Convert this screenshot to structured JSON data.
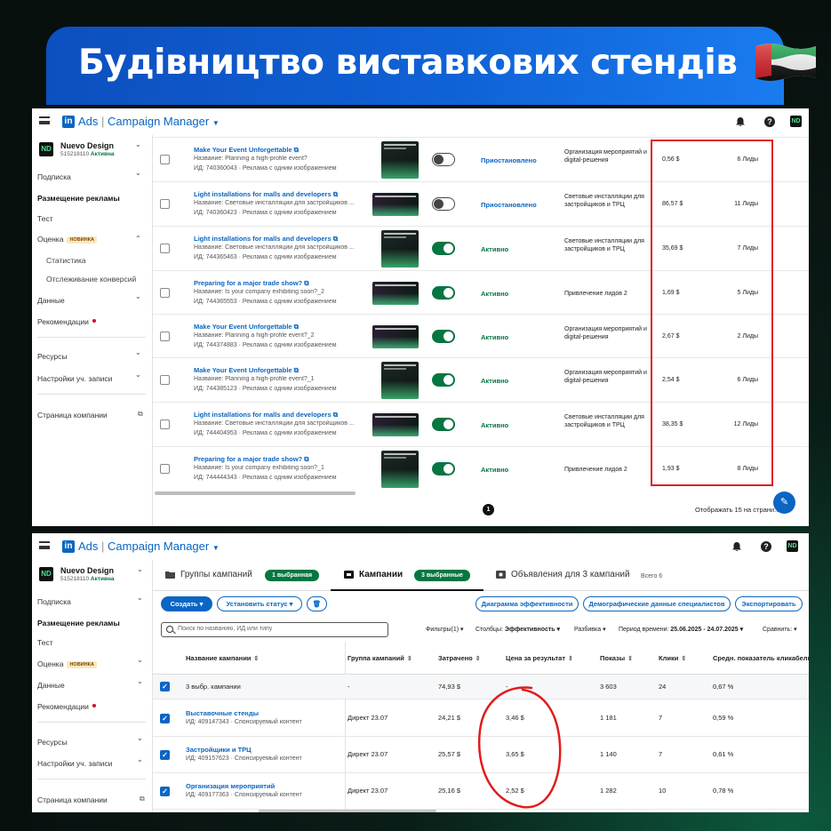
{
  "banner": {
    "title": "Будівництво виставкових стендів"
  },
  "app": {
    "logo_glyph": "in",
    "brand_ads": "Ads",
    "brand_sep": "|",
    "brand_name": "Campaign Manager",
    "brand_caret": "▼",
    "help_glyph": "?",
    "app_glyph": "ND",
    "account_glyph": "ND"
  },
  "account": {
    "name": "Nuevo Design",
    "id": "515218110",
    "status": "Активна"
  },
  "sidebar": {
    "subscription": "Подписка",
    "ads_placement": "Размещение рекламы",
    "test": "Тест",
    "evaluation": "Оценка",
    "new_badge": "НОВИНКА",
    "statistics": "Статистика",
    "conversion_tracking": "Отслеживание конверсий",
    "data": "Данные",
    "recommendations": "Рекомендации",
    "resources": "Ресурсы",
    "account_settings": "Настройки уч. записи",
    "company_page": "Страница компании",
    "chevron_down": "⌄",
    "chevron_up": "⌃",
    "external": "⧉"
  },
  "ads_table": {
    "rows": [
      {
        "title": "Make Your Event Unforgettable ⧉",
        "name": "Название: Planning a high-profile event?",
        "id": "ИД: 740360043 · Реклама с одним изображением",
        "status": "Приостановлено",
        "active": false,
        "goal": "Организация мероприятий и digital-решения",
        "cost": "0,56 $",
        "leads": "6 Лиды",
        "thumb": "tall"
      },
      {
        "title": "Light installations for malls and developers ⧉",
        "name": "Название: Световые инсталляции для застройщиков ...",
        "id": "ИД: 740360423 · Реклама с одним изображением",
        "status": "Приостановлено",
        "active": false,
        "goal": "Световые инсталляции для застройщиков и ТРЦ",
        "cost": "86,57 $",
        "leads": "11 Лиды",
        "thumb": "wide"
      },
      {
        "title": "Light installations for malls and developers ⧉",
        "name": "Название: Световые инсталляции для застройщиков ...",
        "id": "ИД: 744365463 · Реклама с одним изображением",
        "status": "Активно",
        "active": true,
        "goal": "Световые инсталляции для застройщиков и ТРЦ",
        "cost": "35,69 $",
        "leads": "7 Лиды",
        "thumb": "tall"
      },
      {
        "title": "Preparing for a major trade show? ⧉",
        "name": "Название: Is your company exhibiting soon?_2",
        "id": "ИД: 744365553 · Реклама с одним изображением",
        "status": "Активно",
        "active": true,
        "goal": "Привлечение лидов 2",
        "cost": "1,69 $",
        "leads": "5 Лиды",
        "thumb": "wide"
      },
      {
        "title": "Make Your Event Unforgettable ⧉",
        "name": "Название: Planning a high-profile event?_2",
        "id": "ИД: 744374883 · Реклама с одним изображением",
        "status": "Активно",
        "active": true,
        "goal": "Организация мероприятий и digital-решения",
        "cost": "2,67 $",
        "leads": "2 Лиды",
        "thumb": "wide"
      },
      {
        "title": "Make Your Event Unforgettable ⧉",
        "name": "Название: Planning a high-profile event?_1",
        "id": "ИД: 744385123 · Реклама с одним изображением",
        "status": "Активно",
        "active": true,
        "goal": "Организация мероприятий и digital-решения",
        "cost": "2,54 $",
        "leads": "6 Лиды",
        "thumb": "tall"
      },
      {
        "title": "Light installations for malls and developers ⧉",
        "name": "Название: Световые инсталляции для застройщиков ...",
        "id": "ИД: 744404953 · Реклама с одним изображением",
        "status": "Активно",
        "active": true,
        "goal": "Световые инсталляции для застройщиков и ТРЦ",
        "cost": "38,35 $",
        "leads": "12 Лиды",
        "thumb": "wide"
      },
      {
        "title": "Preparing for a major trade show? ⧉",
        "name": "Название: Is your company exhibiting soon?_1",
        "id": "ИД: 744444343 · Реклама с одним изображением",
        "status": "Активно",
        "active": true,
        "goal": "Привлечение лидов 2",
        "cost": "1,93 $",
        "leads": "8 Лиды",
        "thumb": "tall"
      }
    ],
    "page": "1",
    "showing": "Отображать 15 на страни...",
    "chat_glyph": "✎"
  },
  "campaigns": {
    "tab_groups": "Группы кампаний",
    "tab_groups_pill": "1 выбранная",
    "tab_campaigns": "Кампании",
    "tab_campaigns_pill": "3 выбранные",
    "tab_ads": "Объявления для 3 кампаний",
    "total": "Всего 6",
    "create_btn": "Создать ▾",
    "set_status_btn": "Установить статус ▾",
    "trash_glyph": "🗑",
    "perf_chart_btn": "Диаграмма эффективности",
    "demographics_btn": "Демографические данные специалистов",
    "export_btn": "Экспортировать",
    "search_placeholder": "Поиск по названию, ИД или типу",
    "filters": "Фильтры(1) ▾",
    "columns_label": "Столбцы:",
    "columns_value": "Эффективность ▾",
    "breakdown": "Разбивка ▾",
    "period_label": "Период времени:",
    "period_value": "25.06.2025 - 24.07.2025 ▾",
    "compare": "Сравнить: ▾",
    "headers": {
      "name": "Название кампании",
      "group": "Группа кампаний",
      "spent": "Затрачено",
      "cpr": "Цена за результат",
      "impressions": "Показы",
      "clicks": "Клики",
      "ctr": "Средн. показатель кликабельн"
    },
    "sort_glyph": "⇕",
    "check_glyph": "✓",
    "summary": {
      "name": "3 выбр. кампании",
      "group": "-",
      "spent": "74,93 $",
      "cpr": "-",
      "impressions": "3 603",
      "clicks": "24",
      "ctr": "0,67 %"
    },
    "rows": [
      {
        "name": "Выставочные стенды",
        "id": "ИД: 409147343 · Спонсируемый контент",
        "group": "Директ 23.07",
        "spent": "24,21 $",
        "cpr": "3,46 $",
        "impressions": "1 181",
        "clicks": "7",
        "ctr": "0,59 %"
      },
      {
        "name": "Застройщики и ТРЦ",
        "id": "ИД: 409157623 · Спонсируемый контент",
        "group": "Директ 23.07",
        "spent": "25,57 $",
        "cpr": "3,65 $",
        "impressions": "1 140",
        "clicks": "7",
        "ctr": "0,61 %"
      },
      {
        "name": "Организация мероприятий",
        "id": "ИД: 409177363 · Спонсируемый контент",
        "group": "Директ 23.07",
        "spent": "25,16 $",
        "cpr": "2,52 $",
        "impressions": "1 282",
        "clicks": "10",
        "ctr": "0,78 %"
      }
    ]
  },
  "colors": {
    "accent_blue": "#0a66c2",
    "active_green": "#057642",
    "highlight_red": "#e01c1c"
  }
}
